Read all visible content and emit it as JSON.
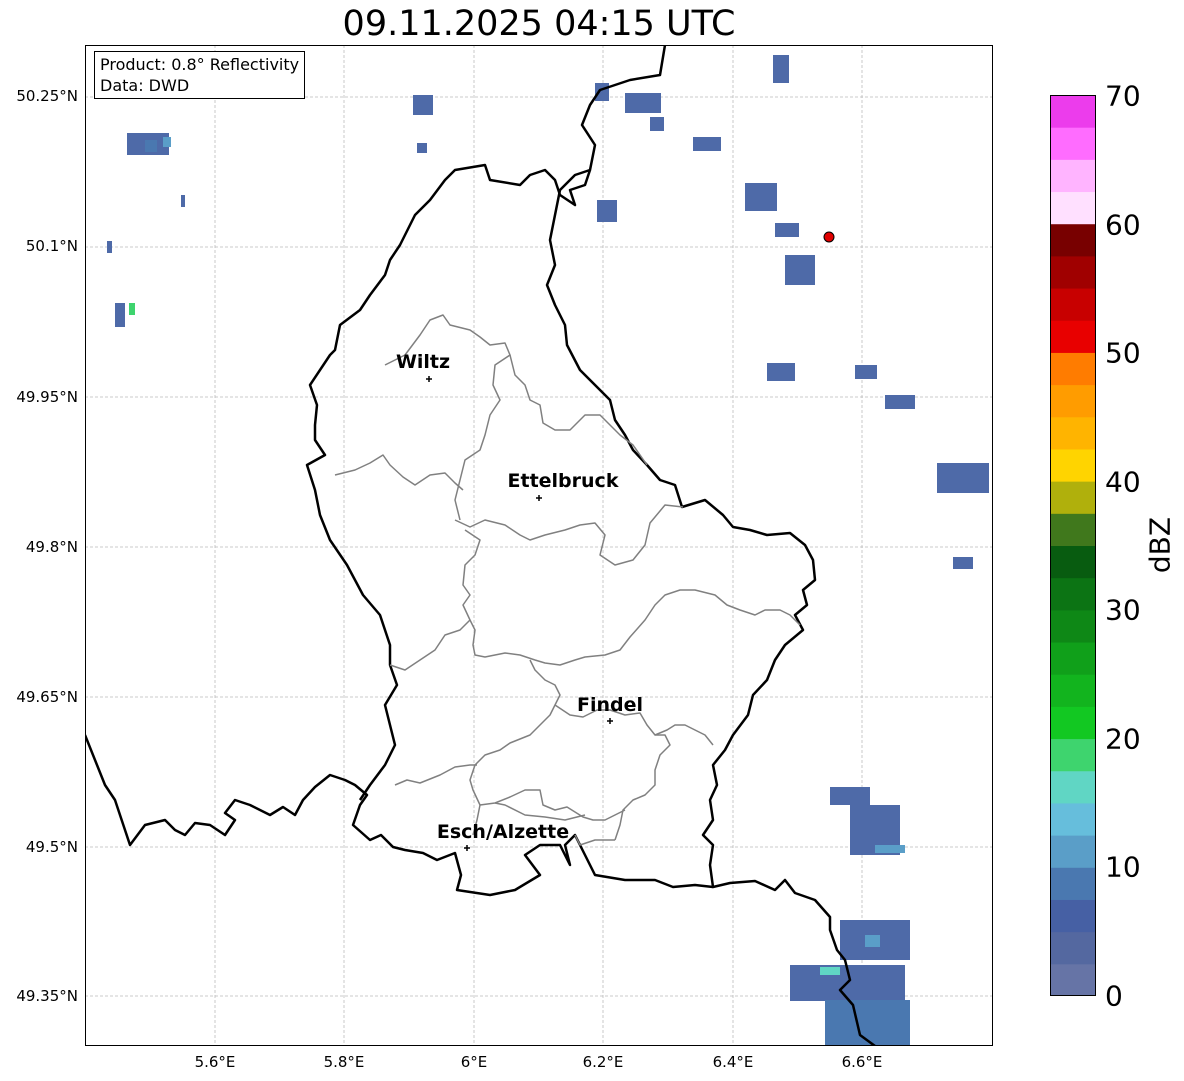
{
  "title": "09.11.2025 04:15 UTC",
  "info": {
    "product": "Product: 0.8° Reflectivity",
    "data": "Data: DWD"
  },
  "lat_ticks": [
    "50.25°N",
    "50.1°N",
    "49.95°N",
    "49.8°N",
    "49.65°N",
    "49.5°N",
    "49.35°N"
  ],
  "lon_ticks": [
    "5.6°E",
    "5.8°E",
    "6°E",
    "6.2°E",
    "6.4°E",
    "6.6°E"
  ],
  "cities": [
    {
      "name": "Wiltz"
    },
    {
      "name": "Ettelbruck"
    },
    {
      "name": "Findel"
    },
    {
      "name": "Esch/Alzette"
    }
  ],
  "colorbar": {
    "title": "dBZ",
    "ticks": [
      "0",
      "10",
      "20",
      "30",
      "40",
      "50",
      "60",
      "70"
    ],
    "min": 0,
    "max": 70,
    "step": 2.5,
    "colors": [
      "#6674a6",
      "#5468a0",
      "#4660a4",
      "#4a78b0",
      "#5a9ec8",
      "#66bedc",
      "#60d6c4",
      "#3ed46e",
      "#12c822",
      "#12b41e",
      "#10a01a",
      "#0e8816",
      "#0c7414",
      "#085c10",
      "#40781c",
      "#b0b00c",
      "#ffd400",
      "#ffb400",
      "#ff9c00",
      "#ff7c00",
      "#e80000",
      "#c80000",
      "#a00000",
      "#780000",
      "#ffe0ff",
      "#ffb4ff",
      "#ff6cff",
      "#ec3cec"
    ]
  },
  "colors": {
    "border": "#000000",
    "canton_border": "#808080",
    "grid": "#bbbbbb",
    "radar_site": "#e00000"
  }
}
